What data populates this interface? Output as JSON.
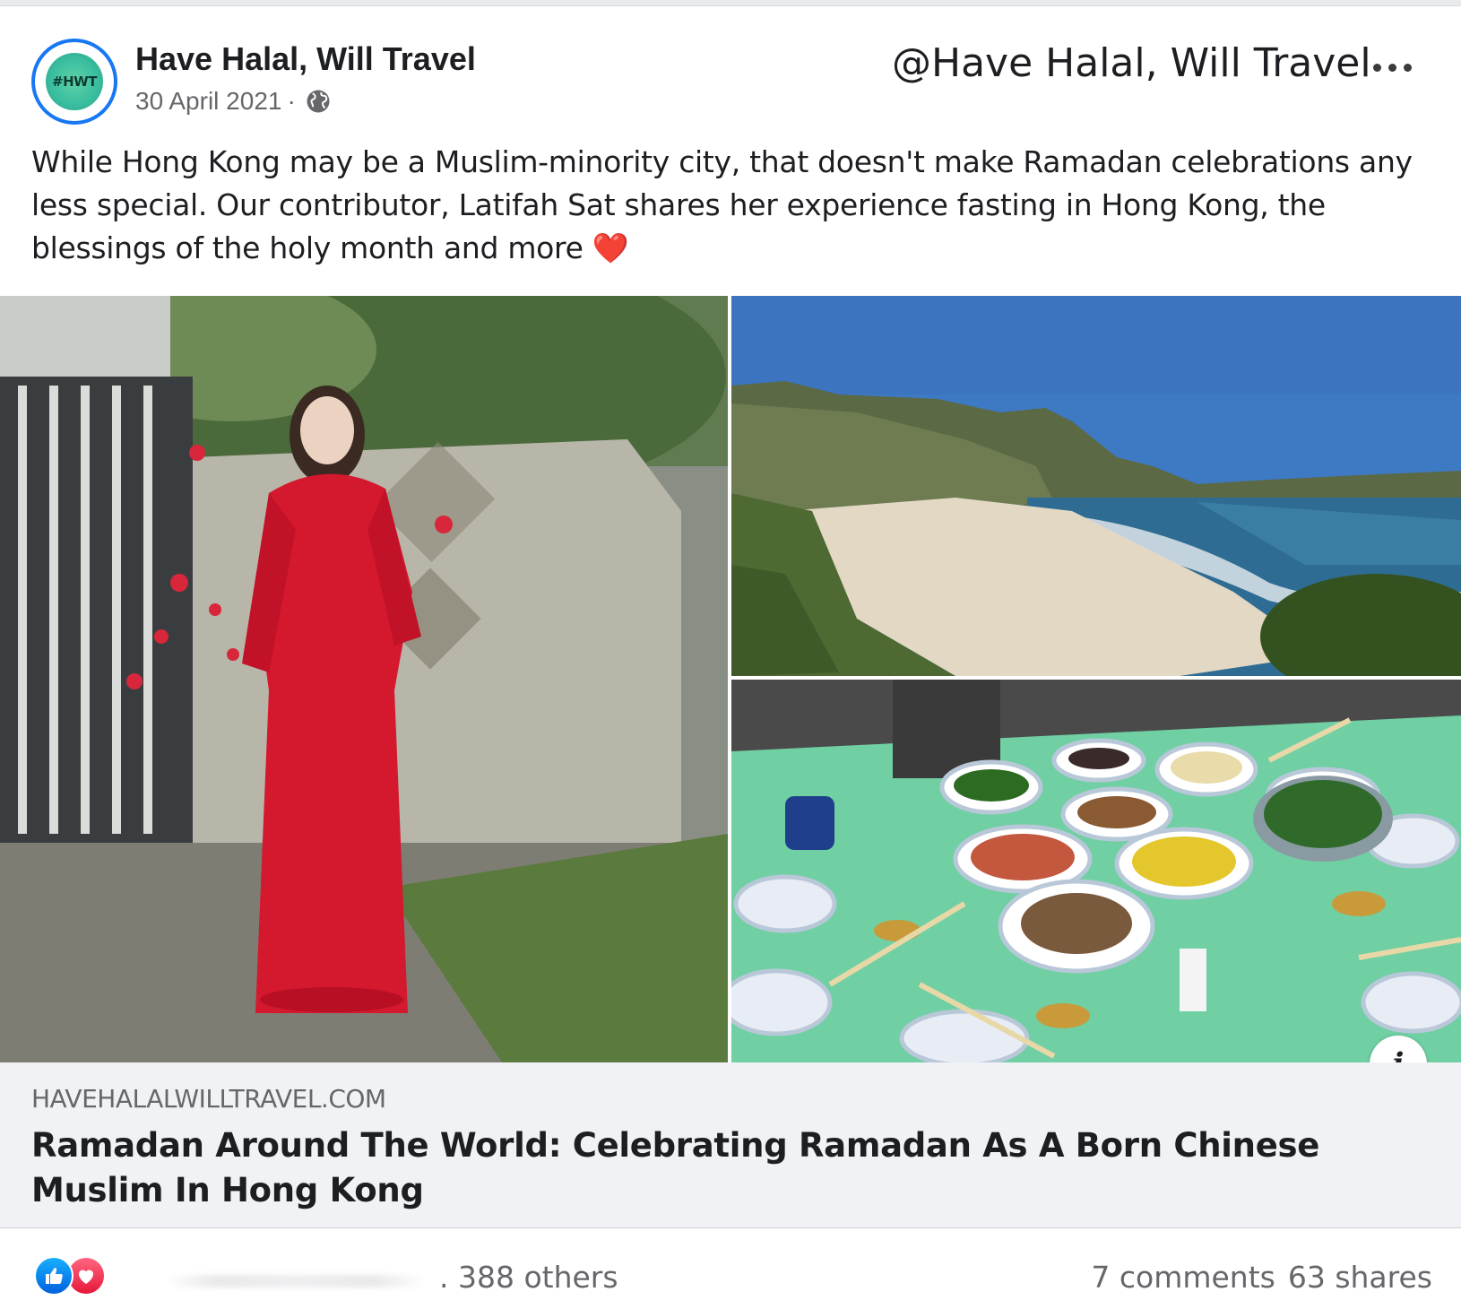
{
  "post": {
    "page_name": "Have Halal, Will Travel",
    "avatar_text": "#HWT",
    "date": "30 April 2021",
    "date_separator": "·",
    "privacy_icon": "globe-icon",
    "watermark": "@Have Halal, Will Travel",
    "more_icon": "more-options-icon",
    "text": "While Hong Kong may be a Muslim-minority city, that doesn't make Ramadan celebrations any less special. Our contributor, Latifah Sat shares her experience fasting in Hong Kong, the blessings of the holy month and more",
    "text_emoji": "❤️"
  },
  "link_preview": {
    "domain": "HAVEHALALWILLTRAVEL.COM",
    "title": "Ramadan Around The World: Celebrating Ramadan As A Born Chinese Muslim In Hong Kong",
    "info_icon": "i"
  },
  "footer": {
    "reaction_icons": [
      "like-icon",
      "love-icon"
    ],
    "others": ". 388 others",
    "comments": "7 comments",
    "shares": "63 shares"
  },
  "colors": {
    "brand_blue": "#1877f2",
    "like": "#1877f2",
    "love": "#e41e3f",
    "text_primary": "#1c1e21",
    "text_secondary": "#65676b",
    "link_bg": "#f0f2f5"
  }
}
